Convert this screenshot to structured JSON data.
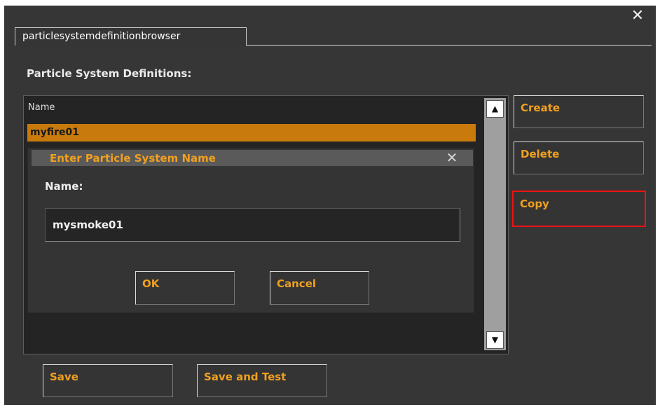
{
  "window": {
    "close_glyph": "✕"
  },
  "tab": {
    "label": "particlesystemdefinitionbrowser"
  },
  "section": {
    "title": "Particle System Definitions:"
  },
  "list": {
    "header": "Name",
    "items": [
      {
        "label": "myfire01",
        "selected": true
      }
    ]
  },
  "scrollbar": {
    "up_glyph": "▲",
    "down_glyph": "▼"
  },
  "side_buttons": {
    "create": "Create",
    "delete": "Delete",
    "copy": "Copy"
  },
  "dialog": {
    "title": "Enter Particle System Name",
    "close_glyph": "✕",
    "name_label": "Name:",
    "name_value": "mysmoke01",
    "ok": "OK",
    "cancel": "Cancel"
  },
  "bottom_buttons": {
    "save": "Save",
    "save_and_test": "Save and Test"
  },
  "colors": {
    "background": "#363636",
    "accent_text": "#f0a020",
    "selected_row": "#c87a0d",
    "highlight_border": "#ee1111"
  },
  "icons": {
    "window_close": "close-icon",
    "dialog_close": "close-icon",
    "scroll_up": "arrow-up-icon",
    "scroll_down": "arrow-down-icon"
  }
}
